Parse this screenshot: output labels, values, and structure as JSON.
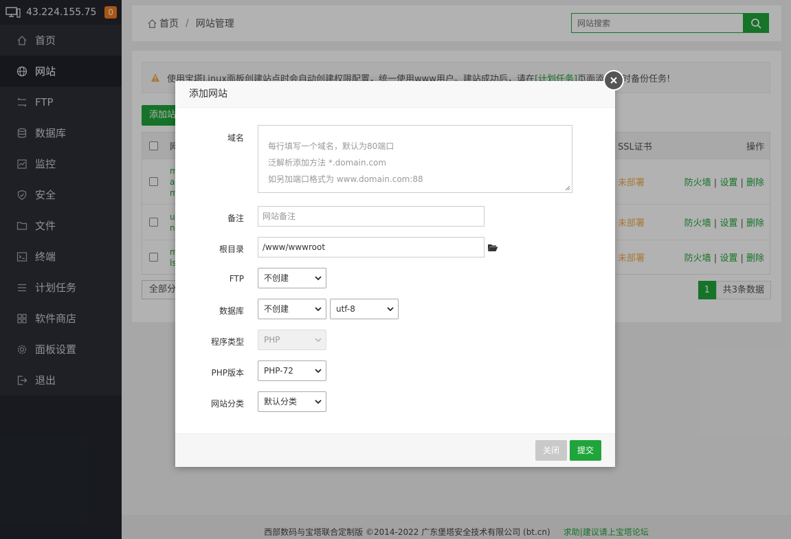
{
  "sidebar": {
    "server_ip": "43.224.155.75",
    "badge_count": "0",
    "items": [
      {
        "label": "首页",
        "icon": "home-icon"
      },
      {
        "label": "网站",
        "icon": "globe-icon"
      },
      {
        "label": "FTP",
        "icon": "ftp-icon"
      },
      {
        "label": "数据库",
        "icon": "database-icon"
      },
      {
        "label": "监控",
        "icon": "monitor-icon"
      },
      {
        "label": "安全",
        "icon": "shield-icon"
      },
      {
        "label": "文件",
        "icon": "folder-icon"
      },
      {
        "label": "终端",
        "icon": "terminal-icon"
      },
      {
        "label": "计划任务",
        "icon": "tasks-icon"
      },
      {
        "label": "软件商店",
        "icon": "store-icon"
      },
      {
        "label": "面板设置",
        "icon": "gear-icon"
      },
      {
        "label": "退出",
        "icon": "logout-icon"
      }
    ],
    "active_index": 1
  },
  "breadcrumb": {
    "home": "首页",
    "separator": "/",
    "current": "网站管理"
  },
  "search": {
    "placeholder": "网站搜索"
  },
  "notice": {
    "text_before": "使用宝塔Linux面板创建站点时会自动创建权限配置，统一使用www用户。建站成功后，请在",
    "link": "[计划任务]",
    "text_after": "页面添加定时备份任务!"
  },
  "site_list": {
    "add_button": "添加站点",
    "columns": {
      "name": "网",
      "ssl": "SSL证书",
      "ops": "操作"
    },
    "rows": [
      {
        "name_lines": [
          "m",
          "az",
          "m"
        ],
        "ssl": "未部署",
        "op_firewall": "防火墙",
        "op_settings": "设置",
        "op_delete": "删除"
      },
      {
        "name_lines": [
          "us",
          "ne"
        ],
        "ssl": "未部署",
        "op_firewall": "防火墙",
        "op_settings": "设置",
        "op_delete": "删除"
      },
      {
        "name_lines": [
          "m",
          "ls"
        ],
        "ssl": "未部署",
        "op_firewall": "防火墙",
        "op_settings": "设置",
        "op_delete": "删除"
      }
    ],
    "category_filter": "全部分类",
    "pager": {
      "current": "1",
      "total": "共3条数据"
    }
  },
  "footer": {
    "copyright": "西部数码与宝塔联合定制版 ©2014-2022 广东堡塔安全技术有限公司 (bt.cn)",
    "link": "求助|建议请上宝塔论坛"
  },
  "modal": {
    "title": "添加网站",
    "domain": {
      "label": "域名",
      "placeholder_lines": [
        "每行填写一个域名，默认为80端口",
        "泛解析添加方法 *.domain.com",
        "如另加端口格式为 www.domain.com:88"
      ]
    },
    "remark": {
      "label": "备注",
      "placeholder": "网站备注"
    },
    "root_dir": {
      "label": "根目录",
      "value": "/www/wwwroot"
    },
    "ftp": {
      "label": "FTP",
      "value": "不创建"
    },
    "database": {
      "label": "数据库",
      "value": "不创建",
      "charset": "utf-8"
    },
    "program_type": {
      "label": "程序类型",
      "value": "PHP"
    },
    "php_version": {
      "label": "PHP版本",
      "value": "PHP-72"
    },
    "site_category": {
      "label": "网站分类",
      "value": "默认分类"
    },
    "close_button": "关闭",
    "submit_button": "提交"
  },
  "colors": {
    "brand_green": "#20a53a",
    "sidebar_bg": "#2b2f37",
    "warning_orange": "#f0ad4e"
  }
}
